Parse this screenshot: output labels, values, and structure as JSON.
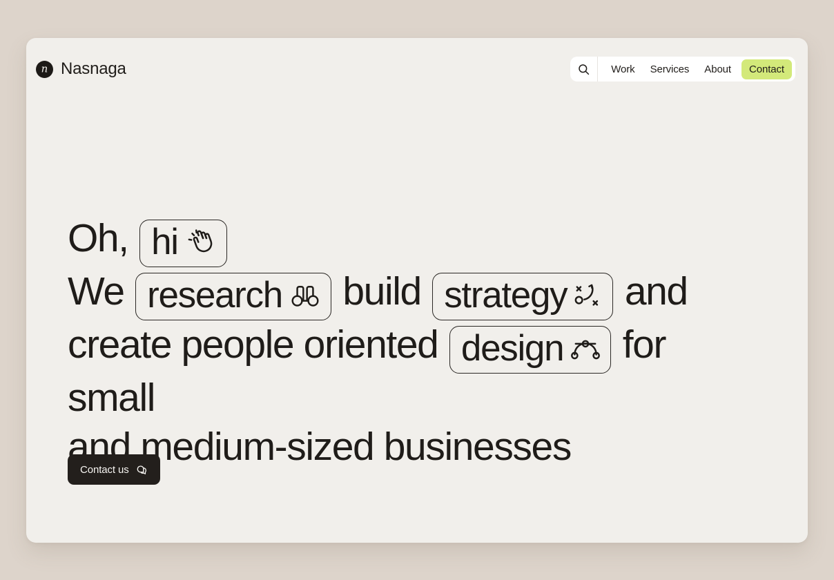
{
  "theme": {
    "page_background": "#ddd4cb",
    "card_background": "#f1efeb",
    "text_color": "#1f1c19",
    "accent_lime": "#d3e97a",
    "dark_button": "#231f1c"
  },
  "header": {
    "brand": {
      "mark_letter": "n",
      "mark_icon": "logo-circle-n-icon",
      "name": "Nasnaga"
    },
    "nav": {
      "search_icon": "search-icon",
      "items": [
        {
          "label": "Work",
          "accent": false
        },
        {
          "label": "Services",
          "accent": false
        },
        {
          "label": "About",
          "accent": false
        },
        {
          "label": "Contact",
          "accent": true
        }
      ]
    }
  },
  "hero": {
    "line1": {
      "prefix": "Oh,",
      "chip": {
        "text": "hi",
        "icon": "waving-hand-icon"
      }
    },
    "line2": {
      "prefix": "We",
      "chip_a": {
        "text": "research",
        "icon": "binoculars-icon"
      },
      "middle": "build",
      "chip_b": {
        "text": "strategy",
        "icon": "strategy-playbook-icon"
      },
      "suffix": "and"
    },
    "line3": {
      "prefix": "create people oriented",
      "chip": {
        "text": "design",
        "icon": "bezier-curve-icon"
      },
      "suffix": "for small"
    },
    "line4": {
      "text": "and medium-sized businesses"
    }
  },
  "cta": {
    "label": "Contact us",
    "icon": "chat-bubbles-icon"
  }
}
